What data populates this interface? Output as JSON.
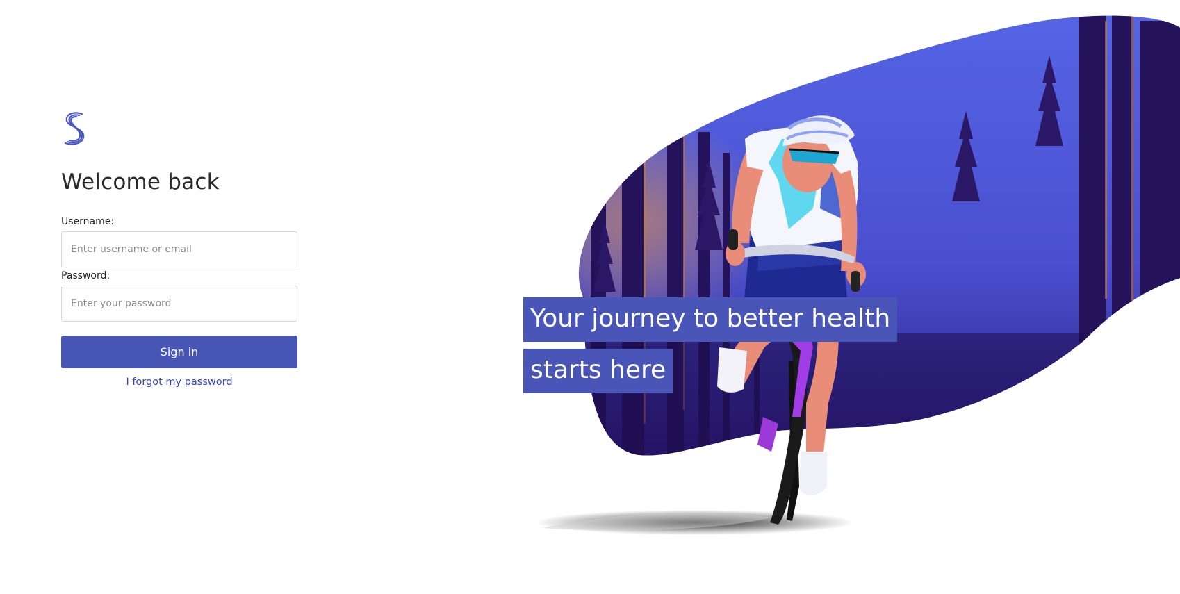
{
  "login": {
    "title": "Welcome back",
    "username_label": "Username:",
    "username_placeholder": "Enter username or email",
    "password_label": "Password:",
    "password_placeholder": "Enter your password",
    "signin_label": "Sign in",
    "forgot_label": "I forgot my password",
    "logo_icon": "s-wave-logo-icon"
  },
  "hero": {
    "tagline_line1": "Your journey to better health",
    "tagline_line2": "starts here",
    "illustration": "cyclist-in-forest-illustration"
  },
  "colors": {
    "primary": "#4756b5",
    "link": "#3744b3",
    "tagline_bg": "#4a55b8",
    "blob_light": "#5060e0",
    "blob_dark": "#1f0f52"
  }
}
